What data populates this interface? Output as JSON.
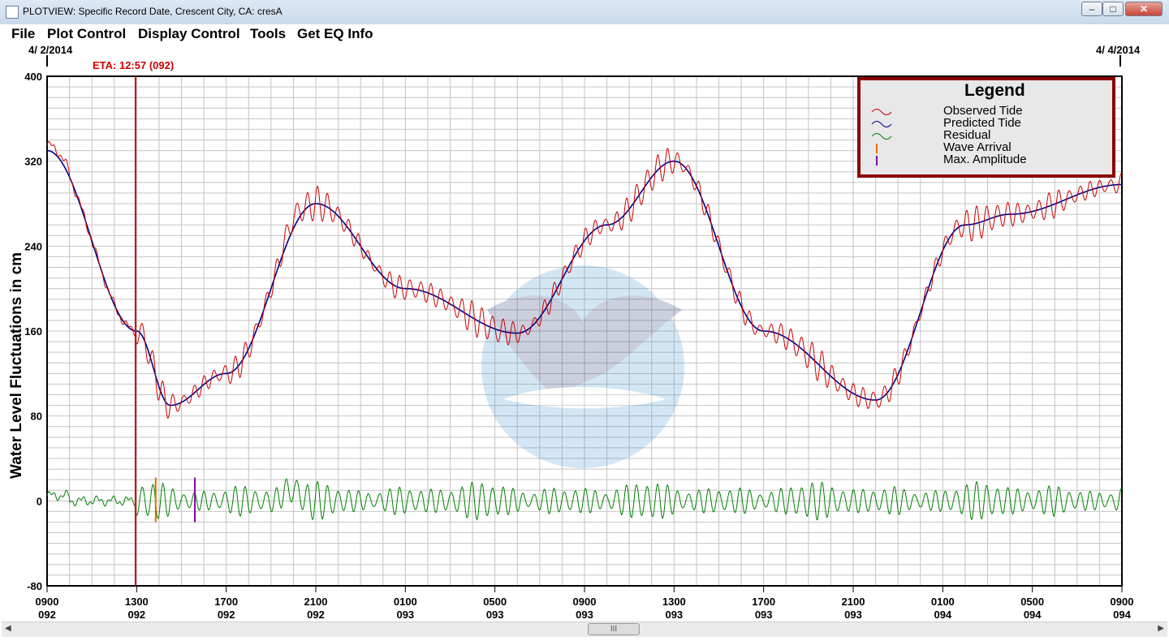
{
  "window": {
    "title": "PLOTVIEW: Specific Record Date, Crescent City, CA: cresA",
    "minimize_glyph": "–",
    "maximize_glyph": "□",
    "close_glyph": "✕"
  },
  "menu": [
    "File",
    "Plot Control",
    "Display Control",
    "Tools",
    "Get EQ Info"
  ],
  "dates": {
    "start": "4/ 2/2014",
    "end": "4/ 4/2014"
  },
  "eta_label": "ETA: 12:57 (092)",
  "scrollbar": {
    "thumb_glyph": "III",
    "left_arrow": "◀",
    "right_arrow": "▶"
  },
  "chart_data": {
    "type": "line",
    "ylabel": "Water Level Fluctuations in cm",
    "ylim": [
      -80,
      400
    ],
    "yticks": [
      400,
      320,
      240,
      160,
      80,
      0,
      -80
    ],
    "grid": true,
    "x_range_hours": [
      0,
      48
    ],
    "xtick_hours": [
      0,
      4,
      8,
      12,
      16,
      20,
      24,
      28,
      32,
      36,
      40,
      44,
      48
    ],
    "xticks": [
      {
        "time": "0900",
        "day": "092"
      },
      {
        "time": "1300",
        "day": "092"
      },
      {
        "time": "1700",
        "day": "092"
      },
      {
        "time": "2100",
        "day": "092"
      },
      {
        "time": "0100",
        "day": "093"
      },
      {
        "time": "0500",
        "day": "093"
      },
      {
        "time": "0900",
        "day": "093"
      },
      {
        "time": "1300",
        "day": "093"
      },
      {
        "time": "1700",
        "day": "093"
      },
      {
        "time": "2100",
        "day": "093"
      },
      {
        "time": "0100",
        "day": "094"
      },
      {
        "time": "0500",
        "day": "094"
      },
      {
        "time": "0900",
        "day": "094"
      }
    ],
    "legend": {
      "title": "Legend",
      "placement": "top-right",
      "entries": [
        {
          "label": "Observed Tide",
          "color": "#cc0000"
        },
        {
          "label": "Predicted Tide",
          "color": "#00008b"
        },
        {
          "label": "Residual",
          "color": "#008000"
        },
        {
          "label": "Wave Arrival",
          "color": "#e07000"
        },
        {
          "label": "Max. Amplitude",
          "color": "#8800aa"
        }
      ]
    },
    "predicted_tide": {
      "color": "#00008b",
      "x_hours": [
        0,
        4,
        5.5,
        8,
        12,
        16,
        21,
        25,
        28,
        32,
        37,
        41,
        43,
        48
      ],
      "y_cm": [
        330,
        160,
        90,
        120,
        280,
        200,
        158,
        260,
        320,
        160,
        95,
        260,
        270,
        298
      ]
    },
    "observed_tide": {
      "color": "#cc0000",
      "extremes_cm": [
        334,
        72,
        296,
        141,
        326,
        76,
        285,
        167,
        309
      ]
    },
    "residual": {
      "color": "#008000",
      "range_cm": [
        -25,
        24
      ]
    },
    "eta_hour": 3.95,
    "wave_arrival_hour": 4.85,
    "max_amplitude_hour": 6.6,
    "colors": {
      "eta_line": "#cc0000",
      "wave_arrival": "#e07000",
      "max_amplitude": "#8800aa",
      "legend_border": "#8b0000"
    }
  }
}
